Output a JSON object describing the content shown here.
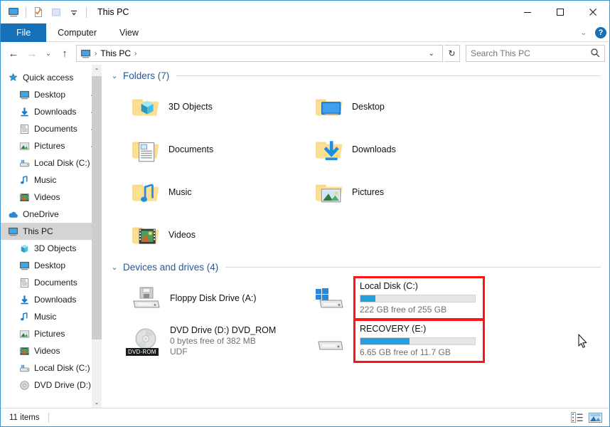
{
  "window": {
    "title": "This PC",
    "quick_access_icons": [
      "this-pc-icon",
      "properties-icon",
      "new-folder-icon",
      "dropdown-caret-icon"
    ],
    "controls": {
      "minimize": "—",
      "maximize": "▢",
      "close": "✕"
    }
  },
  "ribbon": {
    "tabs": [
      {
        "label": "File",
        "active": true
      },
      {
        "label": "Computer",
        "active": false
      },
      {
        "label": "View",
        "active": false
      }
    ],
    "collapse_caret": "⌄",
    "help_label": "?"
  },
  "addressbar": {
    "back": "←",
    "forward": "→",
    "recent": "⌄",
    "up": "↑",
    "breadcrumb": {
      "icon": "this-pc-icon",
      "items": [
        "This PC"
      ],
      "separator": "›"
    },
    "dropdown": "⌄",
    "refresh": "↻",
    "search": {
      "placeholder": "Search This PC",
      "value": ""
    }
  },
  "sidebar": {
    "items": [
      {
        "label": "Quick access",
        "icon": "star-pin-icon",
        "level": 0,
        "pinned": false,
        "selected": false
      },
      {
        "label": "Desktop",
        "icon": "desktop-icon",
        "level": 1,
        "pinned": true,
        "selected": false
      },
      {
        "label": "Downloads",
        "icon": "downloads-icon",
        "level": 1,
        "pinned": true,
        "selected": false
      },
      {
        "label": "Documents",
        "icon": "documents-icon",
        "level": 1,
        "pinned": true,
        "selected": false
      },
      {
        "label": "Pictures",
        "icon": "pictures-icon",
        "level": 1,
        "pinned": true,
        "selected": false
      },
      {
        "label": "Local Disk (C:)",
        "icon": "drive-icon",
        "level": 1,
        "pinned": false,
        "selected": false
      },
      {
        "label": "Music",
        "icon": "music-icon",
        "level": 1,
        "pinned": false,
        "selected": false
      },
      {
        "label": "Videos",
        "icon": "videos-icon",
        "level": 1,
        "pinned": false,
        "selected": false
      },
      {
        "label": "OneDrive",
        "icon": "onedrive-icon",
        "level": 0,
        "pinned": false,
        "selected": false
      },
      {
        "label": "This PC",
        "icon": "this-pc-icon",
        "level": 0,
        "pinned": false,
        "selected": true
      },
      {
        "label": "3D Objects",
        "icon": "3d-objects-icon",
        "level": 1,
        "pinned": false,
        "selected": false
      },
      {
        "label": "Desktop",
        "icon": "desktop-icon",
        "level": 1,
        "pinned": false,
        "selected": false
      },
      {
        "label": "Documents",
        "icon": "documents-icon",
        "level": 1,
        "pinned": false,
        "selected": false
      },
      {
        "label": "Downloads",
        "icon": "downloads-icon",
        "level": 1,
        "pinned": false,
        "selected": false
      },
      {
        "label": "Music",
        "icon": "music-icon",
        "level": 1,
        "pinned": false,
        "selected": false
      },
      {
        "label": "Pictures",
        "icon": "pictures-icon",
        "level": 1,
        "pinned": false,
        "selected": false
      },
      {
        "label": "Videos",
        "icon": "videos-icon",
        "level": 1,
        "pinned": false,
        "selected": false
      },
      {
        "label": "Local Disk (C:)",
        "icon": "drive-icon",
        "level": 1,
        "pinned": false,
        "selected": false
      },
      {
        "label": "DVD Drive (D:) D",
        "icon": "dvd-icon",
        "level": 1,
        "pinned": false,
        "selected": false
      }
    ],
    "scroll_up": "⌃",
    "scroll_down": "⌄"
  },
  "main": {
    "folders_group": {
      "chevron": "⌄",
      "title": "Folders (7)",
      "items": [
        {
          "label": "3D Objects",
          "icon": "folder-3d-objects-icon"
        },
        {
          "label": "Desktop",
          "icon": "folder-desktop-icon"
        },
        {
          "label": "Documents",
          "icon": "folder-documents-icon"
        },
        {
          "label": "Downloads",
          "icon": "folder-downloads-icon"
        },
        {
          "label": "Music",
          "icon": "folder-music-icon"
        },
        {
          "label": "Pictures",
          "icon": "folder-pictures-icon"
        },
        {
          "label": "Videos",
          "icon": "folder-videos-icon"
        }
      ]
    },
    "devices_group": {
      "chevron": "⌄",
      "title": "Devices and drives (4)",
      "items": [
        {
          "name": "Floppy Disk Drive (A:)",
          "icon": "floppy-drive-icon",
          "lines": [],
          "has_bar": false,
          "highlighted": false
        },
        {
          "name": "Local Disk (C:)",
          "icon": "windows-drive-icon",
          "lines": [
            "222 GB free of 255 GB"
          ],
          "has_bar": true,
          "bar_percent": 13,
          "bar_color": "#26a0da",
          "highlighted": true
        },
        {
          "name": "DVD Drive (D:) DVD_ROM",
          "icon": "dvd-drive-icon",
          "badge": "DVD-ROM",
          "lines": [
            "0 bytes free of 382 MB",
            "UDF"
          ],
          "has_bar": false,
          "highlighted": false
        },
        {
          "name": "RECOVERY (E:)",
          "icon": "drive-icon",
          "lines": [
            "6.65 GB free of 11.7 GB"
          ],
          "has_bar": true,
          "bar_percent": 43,
          "bar_color": "#26a0da",
          "highlighted": true
        }
      ]
    }
  },
  "statusbar": {
    "item_count": "11 items",
    "views": [
      {
        "name": "details-view-icon",
        "active": false
      },
      {
        "name": "large-icons-view-icon",
        "active": true
      }
    ]
  },
  "colors": {
    "accent": "#1570b8",
    "group_header": "#2b5797",
    "highlight_box": "#ff1414",
    "bar_fill": "#26a0da",
    "window_border": "#3c93d4",
    "selection": "#d4d4d4"
  }
}
